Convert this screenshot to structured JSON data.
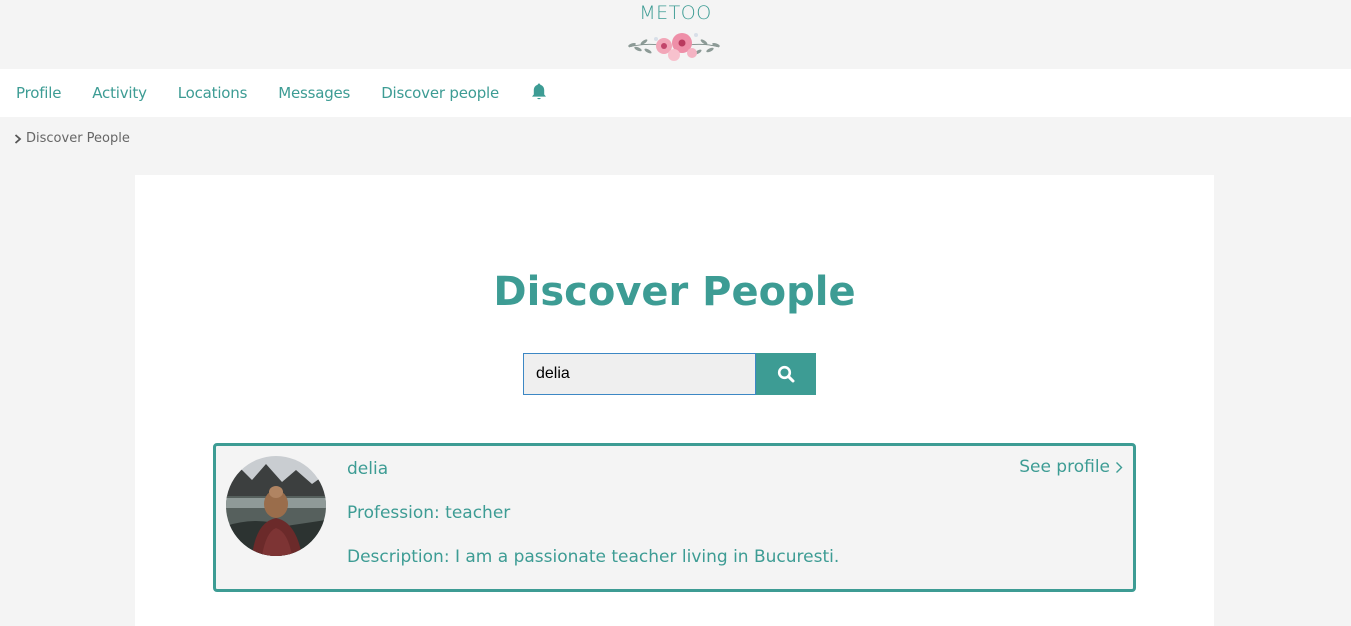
{
  "header": {
    "brand": "METOO"
  },
  "nav": {
    "items": [
      {
        "label": "Profile"
      },
      {
        "label": "Activity"
      },
      {
        "label": "Locations"
      },
      {
        "label": "Messages"
      },
      {
        "label": "Discover people"
      }
    ],
    "notification_icon": "bell-icon"
  },
  "breadcrumb": {
    "current": "Discover People",
    "icon": "chevron-right-icon"
  },
  "main": {
    "title": "Discover People",
    "search": {
      "value": "delia",
      "button_icon": "search-icon"
    },
    "results": [
      {
        "name": "delia",
        "profession_label": "Profession:",
        "profession": "teacher",
        "description_label": "Description:",
        "description": "I am a passionate teacher living in Bucuresti.",
        "link_label": "See profile",
        "link_icon": "chevron-right-icon"
      }
    ]
  },
  "colors": {
    "accent": "#3d9c94",
    "background": "#f4f4f4",
    "input_border": "#3c87c4"
  }
}
